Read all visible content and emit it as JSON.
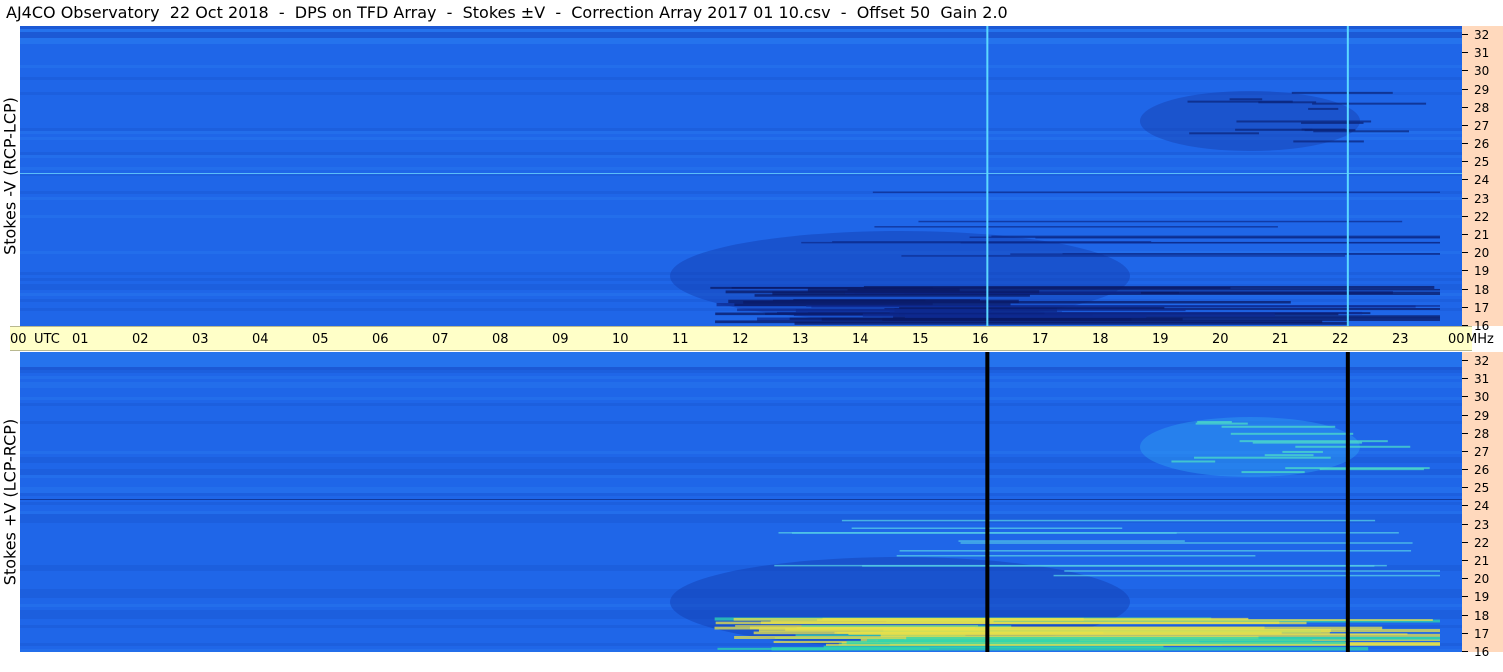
{
  "title": "AJ4CO Observatory  22 Oct 2018  -  DPS on TFD Array  -  Stokes ±V  -  Correction Array 2017 01 10.csv  -  Offset 50  Gain 2.0",
  "panels": {
    "top_label": "Stokes -V (RCP-LCP)",
    "bottom_label": "Stokes +V (LCP-RCP)"
  },
  "time_axis": {
    "labels": [
      "00",
      "UTC",
      "01",
      "02",
      "03",
      "04",
      "05",
      "06",
      "07",
      "08",
      "09",
      "10",
      "11",
      "12",
      "13",
      "14",
      "15",
      "16",
      "17",
      "18",
      "19",
      "20",
      "21",
      "22",
      "23",
      "00",
      "MHz"
    ]
  },
  "freq_axis": {
    "labels": [
      "32",
      "31",
      "30",
      "29",
      "28",
      "27",
      "26",
      "25",
      "24",
      "23",
      "22",
      "21",
      "20",
      "19",
      "18",
      "17",
      "16"
    ]
  },
  "colors": {
    "background": "#1e64e6",
    "axis_time_bg": "#ffffc8",
    "axis_freq_bg": "#ffd9bd"
  },
  "chart_data": {
    "type": "heatmap",
    "panels": [
      "Stokes -V (RCP-LCP)",
      "Stokes +V (LCP-RCP)"
    ],
    "x_range_utc_hours": [
      0,
      24
    ],
    "y_range_mhz": [
      16,
      32
    ],
    "vertical_markers_utc": [
      16.1,
      22.1
    ]
  }
}
